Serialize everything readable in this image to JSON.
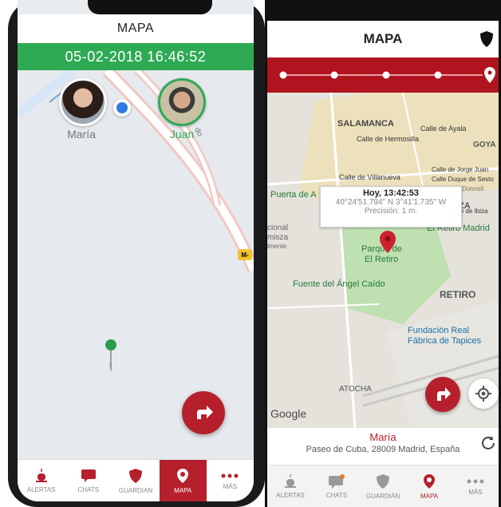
{
  "left": {
    "header_title": "MAPA",
    "date_time": "05-02-2018 16:46:52",
    "avatars": [
      {
        "name": "María"
      },
      {
        "name": "Juan"
      }
    ],
    "road_label_1": "M-",
    "road_label_2": "do",
    "tabs": [
      {
        "label": "ALERTAS",
        "icon": "siren-icon"
      },
      {
        "label": "CHATS",
        "icon": "chat-icon"
      },
      {
        "label": "GUARDIAN",
        "icon": "shield-icon"
      },
      {
        "label": "MAPA",
        "icon": "map-pin-icon"
      },
      {
        "label": "MÁS",
        "icon": "more-icon"
      }
    ]
  },
  "right": {
    "header_title": "MAPA",
    "map_labels": {
      "salamanca": "SALAMANCA",
      "calle_ayala": "Calle de Ayala",
      "calle_hermosilla": "Calle de Hermosilla",
      "goya": "GOYA",
      "calle_villanueva": "Calle de Villanueva",
      "calle_jorge_juan": "Calle de Jorge Juan",
      "calle_duque_sesto": "Calle Duque de Sesto",
      "donnell": "Donnell",
      "puerta_de_a": "Puerta de A",
      "za": "ZA",
      "de_ibiza": "le de Ibiza",
      "el_retiro_madrid": "El Retiro Madrid",
      "cional": "cional",
      "misza": "misza",
      "lmente": "lmente",
      "parque": "Parque de",
      "el_retiro": "El Retiro",
      "fuente": "Fuente del Ángel Caído",
      "retiro": "RETIRO",
      "fundacion_1": "Fundación Real",
      "fundacion_2": "Fábrica de Tapices",
      "atocha": "ATOCHA",
      "google": "Google"
    },
    "popup": {
      "title": "Hoy, 13:42:53",
      "coords": "40°24'51.794\" N  3°41'1.735\" W",
      "precision": "Precisión: 1 m."
    },
    "info_name": "María",
    "info_address": "Paseo de Cuba, 28009 Madrid, España",
    "tabs": [
      {
        "label": "ALERTAS",
        "icon": "siren-icon"
      },
      {
        "label": "CHATS",
        "icon": "chat-icon"
      },
      {
        "label": "GUARDIÁN",
        "icon": "shield-icon"
      },
      {
        "label": "MAPA",
        "icon": "map-pin-icon"
      },
      {
        "label": "MÁS",
        "icon": "more-icon"
      }
    ]
  },
  "colors": {
    "brand_red": "#b5202c",
    "timeline_red": "#b0141f",
    "date_green": "#2eaa55"
  }
}
